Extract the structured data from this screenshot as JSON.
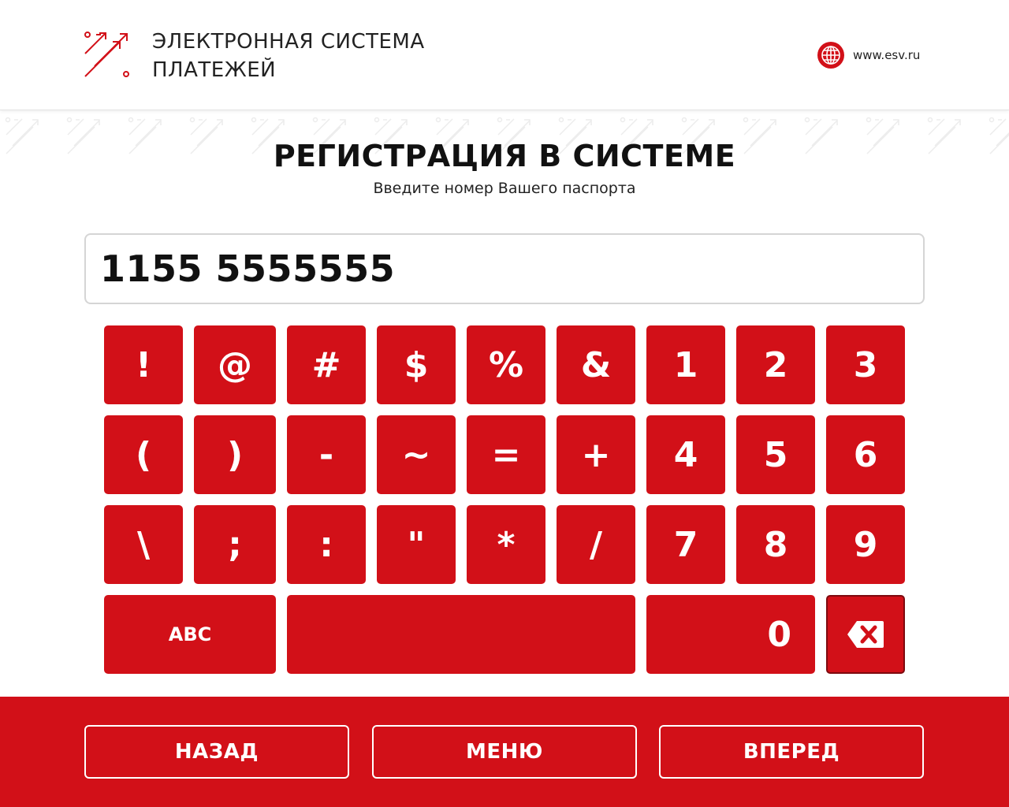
{
  "header": {
    "brand_line1": "ЭЛЕКТРОННАЯ СИСТЕМА",
    "brand_line2": "ПЛАТЕЖЕЙ",
    "site_url": "www.esv.ru",
    "logo_icon": "arrows-logo-icon",
    "site_icon": "globe-icon"
  },
  "page": {
    "title": "РЕГИСТРАЦИЯ В СИСТЕМЕ",
    "subtitle": "Введите номер Вашего паспорта"
  },
  "input": {
    "value": "1155 5555555"
  },
  "keyboard": {
    "row1": [
      "!",
      "@",
      "#",
      "$",
      "%",
      "&",
      "1",
      "2",
      "3"
    ],
    "row2": [
      "(",
      ")",
      "-",
      "~",
      "=",
      "+",
      "4",
      "5",
      "6"
    ],
    "row3": [
      "\\",
      ";",
      ":",
      "\"",
      "*",
      "/",
      "7",
      "8",
      "9"
    ],
    "abc_label": "ABC",
    "space_label": "",
    "zero_label": "0",
    "backspace_icon": "backspace-icon"
  },
  "footer": {
    "back_label": "НАЗАД",
    "menu_label": "МЕНЮ",
    "next_label": "ВПЕРЕД"
  },
  "colors": {
    "accent": "#d21018",
    "text": "#111111",
    "background": "#ffffff"
  }
}
